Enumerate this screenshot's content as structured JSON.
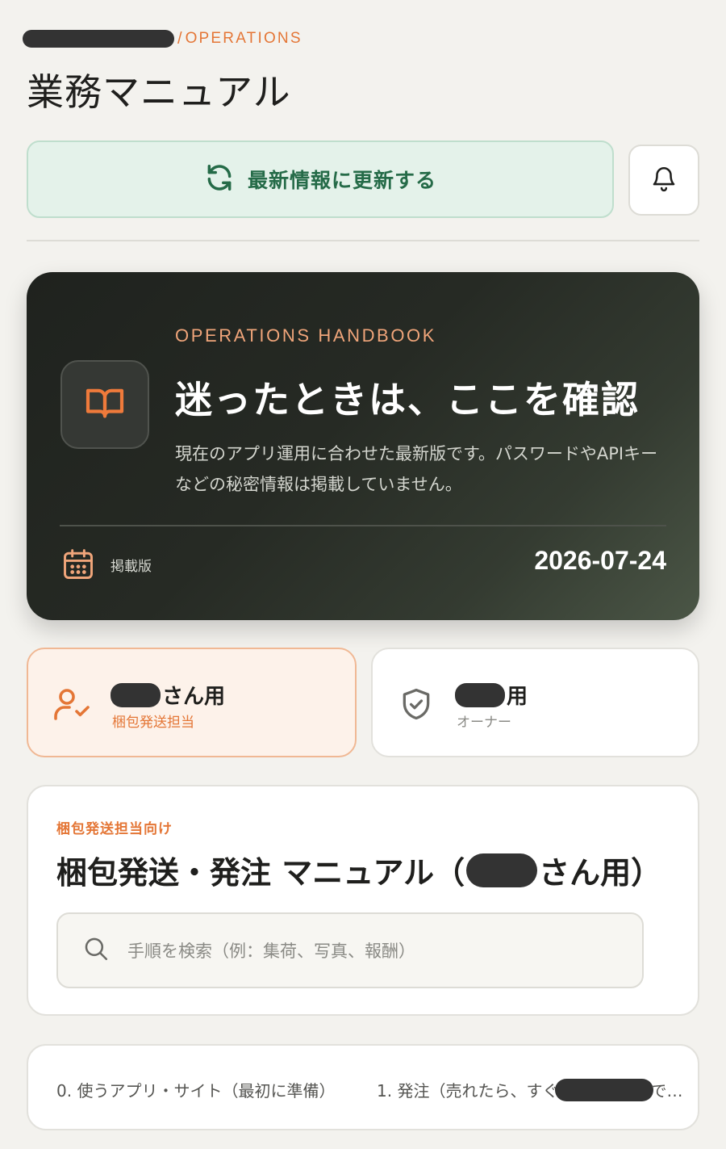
{
  "breadcrumb": {
    "separator": "/",
    "section": "OPERATIONS"
  },
  "page": {
    "title": "業務マニュアル"
  },
  "toolbar": {
    "refresh_label": "最新情報に更新する"
  },
  "hero": {
    "kicker": "OPERATIONS HANDBOOK",
    "heading": "迷ったときは、ここを確認",
    "description": "現在のアプリ運用に合わせた最新版です。パスワードやAPIキーなどの秘密情報は掲載していません。",
    "date_label": "掲載版",
    "date": "2026-07-24"
  },
  "roles": [
    {
      "title_suffix": "さん用",
      "subtitle": "梱包発送担当",
      "selected": true
    },
    {
      "title_suffix": "用",
      "subtitle": "オーナー",
      "selected": false
    }
  ],
  "manual": {
    "kicker": "梱包発送担当向け",
    "title_prefix": "梱包発送・発注 マニュアル（",
    "title_suffix": "さん用）",
    "search_placeholder": "手順を検索（例：集荷、写真、報酬）"
  },
  "toc": {
    "items": [
      {
        "label": "0. 使うアプリ・サイト（最初に準備）"
      },
      {
        "label_prefix": "1. 発注（売れたら、すぐ",
        "label_suffix": "で…"
      }
    ]
  },
  "colors": {
    "accent": "#e47636",
    "success": "#256b48",
    "dark": "#1f221e"
  },
  "icons": [
    "refresh-icon",
    "bell-icon",
    "book-icon",
    "calendar-icon",
    "user-check-icon",
    "shield-check-icon",
    "search-icon"
  ]
}
